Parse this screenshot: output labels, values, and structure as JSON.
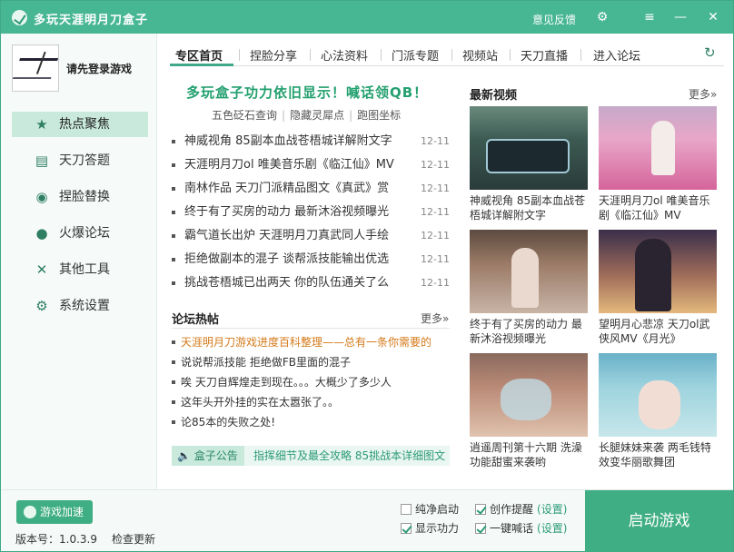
{
  "titlebar": {
    "title": "多玩天涯明月刀盒子",
    "feedback": "意见反馈"
  },
  "sidebar": {
    "login": "请先登录游戏",
    "items": [
      {
        "label": "热点聚焦",
        "icon": "star-icon"
      },
      {
        "label": "天刀答题",
        "icon": "quiz-icon"
      },
      {
        "label": "捏脸替换",
        "icon": "mask-icon"
      },
      {
        "label": "火爆论坛",
        "icon": "chat-icon"
      },
      {
        "label": "其他工具",
        "icon": "tools-icon"
      },
      {
        "label": "系统设置",
        "icon": "gear-icon"
      }
    ]
  },
  "tabs": [
    "专区首页",
    "捏脸分享",
    "心法资料",
    "门派专题",
    "视频站",
    "天刀直播",
    "进入论坛"
  ],
  "news": {
    "headline": "多玩盒子功力依旧显示！喊话领QB！",
    "sublinks": [
      "五色砭石查询",
      "隐藏灵犀点",
      "跑图坐标"
    ],
    "items": [
      {
        "title": "神威视角 85副本血战苍梧城详解附文字",
        "date": "12-11"
      },
      {
        "title": "天涯明月刀ol 唯美音乐剧《临江仙》MV",
        "date": "12-11"
      },
      {
        "title": "南林作品 天刀门派精品图文《真武》赏",
        "date": "12-11"
      },
      {
        "title": "终于有了买房的动力 最新沐浴视频曝光",
        "date": "12-11"
      },
      {
        "title": "霸气道长出炉 天涯明月刀真武同人手绘",
        "date": "12-11"
      },
      {
        "title": "拒绝做副本的混子 谈帮派技能输出优选",
        "date": "12-11"
      },
      {
        "title": "挑战苍梧城已出两天 你的队伍通关了么",
        "date": "12-11"
      }
    ]
  },
  "forum": {
    "title": "论坛热帖",
    "more": "更多»",
    "items": [
      "天涯明月刀游戏进度百科整理——总有一条你需要的",
      "说说帮派技能 拒绝做FB里面的混子",
      "唉 天刀自辉煌走到现在。。。大概少了多少人",
      "这年头开外挂的实在太嚣张了。。",
      "论85本的失败之处!"
    ]
  },
  "notice": {
    "tag": "盒子公告",
    "text": "指挥细节及最全攻略 85挑战本详细图文"
  },
  "videos": {
    "title": "最新视频",
    "more": "更多»",
    "items": [
      {
        "caption": "神威视角 85副本血战苍梧城详解附文字"
      },
      {
        "caption": "天涯明月刀ol 唯美音乐剧《临江仙》MV"
      },
      {
        "caption": "终于有了买房的动力 最新沐浴视频曝光"
      },
      {
        "caption": "望明月心悲凉 天刀ol武侠风MV《月光》"
      },
      {
        "caption": "逍遥周刊第十六期 洗澡功能甜蜜来袭哟"
      },
      {
        "caption": "长腿妹妹来袭 两毛钱特效变华丽歌舞团"
      }
    ]
  },
  "bottom": {
    "speed": "游戏加速",
    "version": "版本号：1.0.3.9",
    "update": "检查更新",
    "options": [
      {
        "label": "纯净启动",
        "checked": false
      },
      {
        "label": "显示功力",
        "checked": true
      },
      {
        "label": "创作提醒",
        "checked": true,
        "setting": "(设置)"
      },
      {
        "label": "一键喊话",
        "checked": true,
        "setting": "(设置)"
      }
    ],
    "start": "启动游戏"
  },
  "colors": {
    "accent": "#47b693",
    "headline": "#23a06f",
    "highlight": "#d47a1a"
  }
}
